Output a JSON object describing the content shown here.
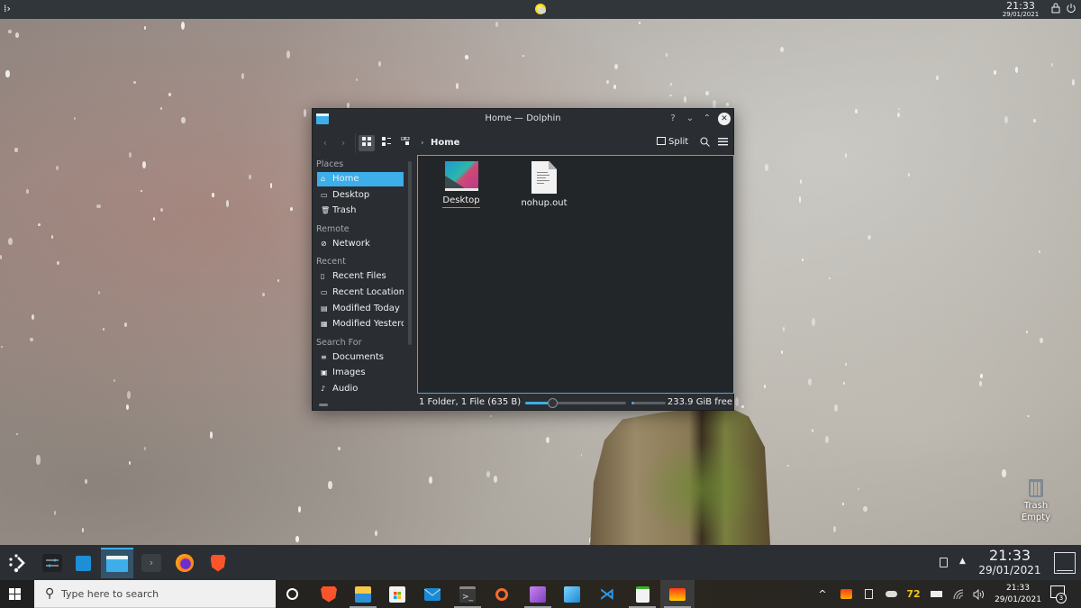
{
  "top_panel": {
    "kicker_icon": "kde-kickoff-icon",
    "weather_icon": "partly-sunny-icon",
    "clock_time": "21:33",
    "clock_date": "29/01/2021",
    "lock_icon": "lock-icon",
    "power_icon": "power-icon"
  },
  "window": {
    "title": "Home — Dolphin",
    "app_icon": "dolphin-folder-icon",
    "buttons": {
      "help": "?",
      "minimize": "⌄",
      "maximize": "⌃",
      "close": "✕"
    },
    "toolbar": {
      "back_icon": "‹",
      "forward_icon": "›",
      "view_modes": [
        "icons",
        "compact",
        "details"
      ],
      "active_view_mode": "icons",
      "breadcrumb_separator": "›",
      "breadcrumb": "Home",
      "split_label": "Split",
      "search_icon": "⌕",
      "menu_icon": "≡"
    },
    "sidebar": {
      "sections": [
        {
          "heading": "Places",
          "items": [
            {
              "label": "Home",
              "icon": "⌂",
              "selected": true
            },
            {
              "label": "Desktop",
              "icon": "▭",
              "selected": false
            },
            {
              "label": "Trash",
              "icon": "🗑",
              "selected": false
            }
          ]
        },
        {
          "heading": "Remote",
          "items": [
            {
              "label": "Network",
              "icon": "⊘",
              "selected": false
            }
          ]
        },
        {
          "heading": "Recent",
          "items": [
            {
              "label": "Recent Files",
              "icon": "▯",
              "selected": false
            },
            {
              "label": "Recent Locations",
              "icon": "▭",
              "selected": false
            },
            {
              "label": "Modified Today",
              "icon": "▤",
              "selected": false
            },
            {
              "label": "Modified Yesterday",
              "icon": "▦",
              "selected": false
            }
          ]
        },
        {
          "heading": "Search For",
          "items": [
            {
              "label": "Documents",
              "icon": "≡",
              "selected": false
            },
            {
              "label": "Images",
              "icon": "▣",
              "selected": false
            },
            {
              "label": "Audio",
              "icon": "♪",
              "selected": false
            }
          ]
        }
      ]
    },
    "files": [
      {
        "name": "Desktop",
        "type": "folder",
        "current": true
      },
      {
        "name": "nohup.out",
        "type": "text-file",
        "current": false
      }
    ],
    "status": {
      "summary": "1 Folder, 1 File (635 B)",
      "zoom_level_fraction": 0.27,
      "space_used_fraction": 0.04,
      "free_space": "233.9 GiB free"
    }
  },
  "desktop": {
    "trash_label_1": "Trash",
    "trash_label_2": "Empty"
  },
  "plasma_panel": {
    "launcher_icon": "kde-launcher-icon",
    "tasks": [
      {
        "name": "system-settings",
        "active": false
      },
      {
        "name": "discover",
        "active": false
      },
      {
        "name": "dolphin",
        "active": true
      },
      {
        "name": "konsole",
        "active": false
      },
      {
        "name": "firefox",
        "active": false
      },
      {
        "name": "brave",
        "active": false
      }
    ],
    "clock_time": "21:33",
    "clock_date": "29/01/2021"
  },
  "windows_taskbar": {
    "search_placeholder": "Type here to search",
    "apps": [
      {
        "name": "brave",
        "open": false
      },
      {
        "name": "file-explorer",
        "open": true
      },
      {
        "name": "microsoft-store",
        "open": false
      },
      {
        "name": "mail",
        "open": false
      },
      {
        "name": "terminal",
        "open": true
      },
      {
        "name": "origin",
        "open": false
      },
      {
        "name": "affinity-photo",
        "open": true
      },
      {
        "name": "affinity-designer",
        "open": false
      },
      {
        "name": "vscode",
        "open": false
      },
      {
        "name": "libreoffice-calc",
        "open": true
      },
      {
        "name": "vcxsrv",
        "open": true,
        "active": true
      }
    ],
    "tray": {
      "overflow_icon": "^",
      "temperature": "72",
      "clock_time": "21:33",
      "clock_date": "29/01/2021",
      "notification_count": "3"
    }
  }
}
